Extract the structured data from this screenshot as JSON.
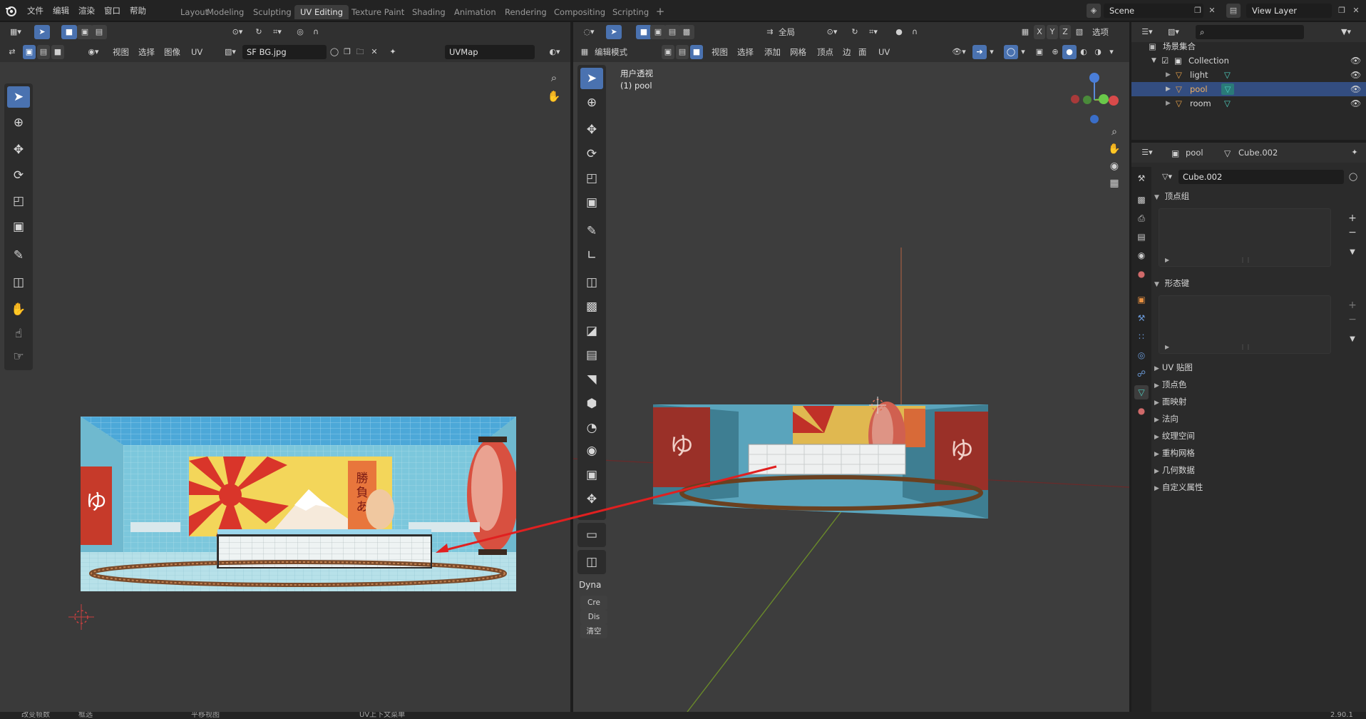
{
  "topbar": {
    "menus": [
      "文件",
      "编辑",
      "渲染",
      "窗口",
      "帮助"
    ],
    "workspaces": [
      "Layout",
      "Modeling",
      "Sculpting",
      "UV Editing",
      "Texture Paint",
      "Shading",
      "Animation",
      "Rendering",
      "Compositing",
      "Scripting"
    ],
    "active_workspace": "UV Editing",
    "scene": "Scene",
    "view_layer": "View Layer"
  },
  "uv_editor": {
    "menus": [
      "视图",
      "选择",
      "图像",
      "UV"
    ],
    "image_name": "SF BG.jpg",
    "uv_map": "UVMap"
  },
  "viewport": {
    "mode": "编辑模式",
    "menus": [
      "视图",
      "选择",
      "添加",
      "网格",
      "顶点",
      "边",
      "面",
      "UV"
    ],
    "transform_orientation": "全局",
    "options_label": "选项",
    "axis_x": "X",
    "axis_y": "Y",
    "axis_z": "Z",
    "overlay_title": "用户透视",
    "overlay_sub": "(1) pool",
    "dyntopo_panel": "Dyna",
    "dyn_create": "Cre",
    "dyn_dissolve": "Dis",
    "dyn_clear": "清空"
  },
  "outliner": {
    "root": "场景集合",
    "collection": "Collection",
    "objects": [
      {
        "name": "light",
        "selected": false
      },
      {
        "name": "pool",
        "selected": true
      },
      {
        "name": "room",
        "selected": false
      }
    ]
  },
  "properties": {
    "object_name": "pool",
    "mesh_name": "Cube.002",
    "mesh_field": "Cube.002",
    "sections": [
      "顶点组",
      "形态键"
    ],
    "collapsed_sections": [
      "UV 贴图",
      "顶点色",
      "面映射",
      "法向",
      "纹理空间",
      "重构网格",
      "几何数据",
      "自定义属性"
    ]
  },
  "statusbar": {
    "left": "改变帧数",
    "left2": "框选",
    "mid": "平移视图",
    "right": "UV上下文菜单",
    "version": "2.90.1"
  },
  "colors": {
    "accent": "#4a72b0",
    "selected_row": "#334d80",
    "red_arrow": "#e02020",
    "mesh_icon": "#e8a24a",
    "data_icon": "#4fcfbf"
  }
}
